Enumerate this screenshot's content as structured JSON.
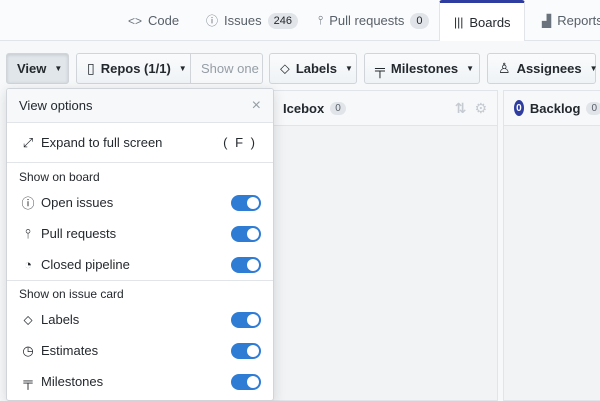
{
  "tabs": [
    {
      "label": "Code",
      "icon": "code-icon",
      "glyph": "<>"
    },
    {
      "label": "Issues",
      "icon": "issue-opened-icon",
      "glyph": "ⓘ",
      "count": "246"
    },
    {
      "label": "Pull requests",
      "icon": "git-pull-request-icon",
      "glyph": "⫯",
      "count": "0"
    },
    {
      "label": "Boards",
      "icon": "boards-icon",
      "glyph": "|||"
    },
    {
      "label": "Reports",
      "icon": "graph-icon",
      "glyph": "▟"
    }
  ],
  "toolbar": {
    "view": "View",
    "repos": "Repos (1/1)",
    "show_one": "Show one",
    "labels": "Labels",
    "milestones": "Milestones",
    "assignees": "Assignees"
  },
  "columns": {
    "icebox": {
      "name": "Icebox",
      "count": "0"
    },
    "backlog": {
      "name": "Backlog",
      "count": "0",
      "badge": "0"
    }
  },
  "view_options": {
    "title": "View options",
    "expand": {
      "label": "Expand to full screen",
      "shortcut": "( F )"
    },
    "show_on_board": {
      "heading": "Show on board",
      "items": [
        {
          "label": "Open issues",
          "icon": "issue-opened-icon",
          "enabled": true
        },
        {
          "label": "Pull requests",
          "icon": "git-pull-request-icon",
          "enabled": true
        },
        {
          "label": "Closed pipeline",
          "icon": "closed-pipeline-icon",
          "enabled": true
        }
      ]
    },
    "show_on_issue_card": {
      "heading": "Show on issue card",
      "items": [
        {
          "label": "Labels",
          "icon": "tag-icon",
          "enabled": true
        },
        {
          "label": "Estimates",
          "icon": "estimate-icon",
          "enabled": true
        },
        {
          "label": "Milestones",
          "icon": "milestone-icon",
          "enabled": true
        }
      ]
    }
  },
  "colors": {
    "accent": "#2f3da0",
    "toggle_on": "#2f7cd5"
  }
}
